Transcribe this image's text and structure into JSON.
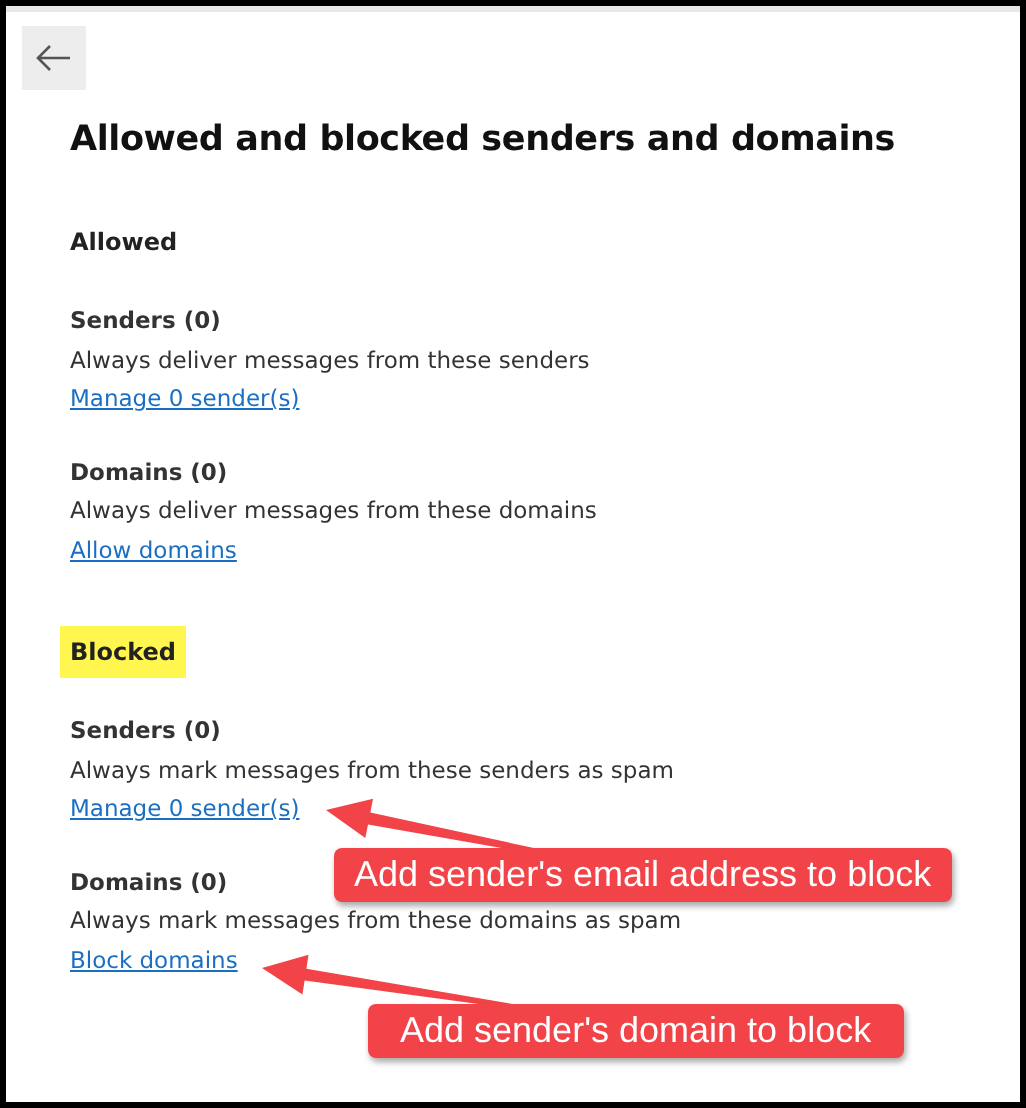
{
  "title": "Allowed and blocked senders and domains",
  "sections": [
    {
      "heading": "Allowed",
      "highlighted": false,
      "items": [
        {
          "title": "Senders (0)",
          "description": "Always deliver messages from these senders",
          "link": "Manage 0 sender(s)"
        },
        {
          "title": "Domains (0)",
          "description": "Always deliver messages from these domains",
          "link": "Allow domains"
        }
      ]
    },
    {
      "heading": "Blocked",
      "highlighted": true,
      "items": [
        {
          "title": "Senders (0)",
          "description": "Always mark messages from these senders as spam",
          "link": "Manage 0 sender(s)"
        },
        {
          "title": "Domains (0)",
          "description": "Always mark messages from these domains as spam",
          "link": "Block domains"
        }
      ]
    }
  ],
  "annotations": [
    {
      "text": "Add sender's email address to block"
    },
    {
      "text": "Add sender's domain to block"
    }
  ]
}
